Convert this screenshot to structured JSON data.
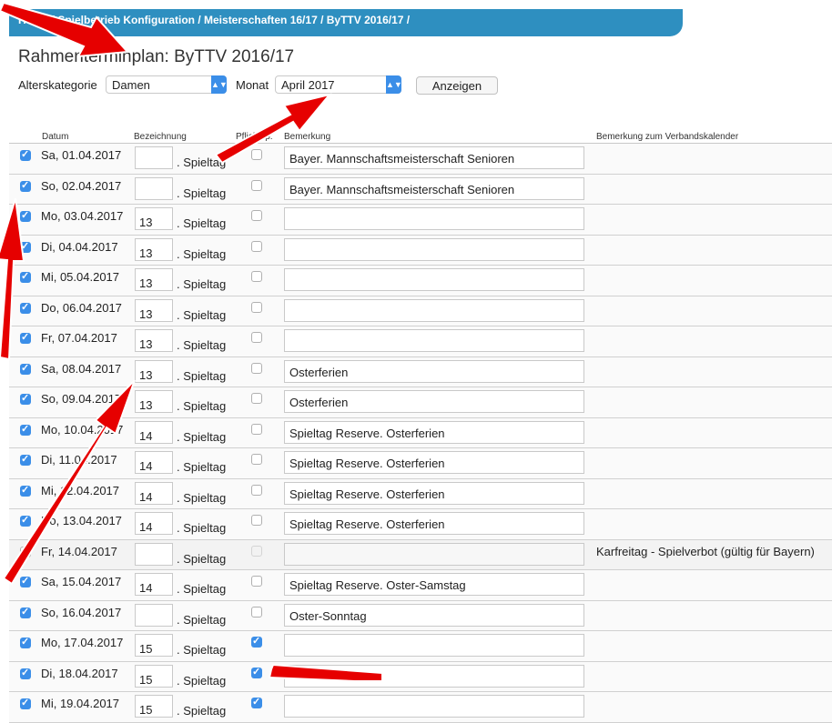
{
  "breadcrumb": "Home / Spielbetrieb Konfiguration / Meisterschaften 16/17 / ByTTV 2016/17 /",
  "page_title": "Rahmenterminplan: ByTTV 2016/17",
  "filters": {
    "alterskategorie_label": "Alterskategorie",
    "alterskategorie_value": "Damen",
    "monat_label": "Monat",
    "monat_value": "April 2017",
    "anzeigen_label": "Anzeigen"
  },
  "columns": {
    "datum": "Datum",
    "bezeichnung": "Bezeichnung",
    "pflicht": "Pflichtsp.",
    "bemerkung": "Bemerkung",
    "verband": "Bemerkung zum Verbandskalender"
  },
  "spieltag_suffix": ". Spieltag",
  "rows": [
    {
      "checked": true,
      "date": "Sa, 01.04.2017",
      "num": "",
      "pflicht": false,
      "pflicht_disabled": false,
      "bemerkung": "Bayer. Mannschaftsmeisterschaft Senioren",
      "verband": "",
      "holiday": false
    },
    {
      "checked": true,
      "date": "So, 02.04.2017",
      "num": "",
      "pflicht": false,
      "pflicht_disabled": false,
      "bemerkung": "Bayer. Mannschaftsmeisterschaft Senioren",
      "verband": "",
      "holiday": false
    },
    {
      "checked": true,
      "date": "Mo, 03.04.2017",
      "num": "13",
      "pflicht": false,
      "pflicht_disabled": false,
      "bemerkung": "",
      "verband": "",
      "holiday": false
    },
    {
      "checked": true,
      "date": "Di, 04.04.2017",
      "num": "13",
      "pflicht": false,
      "pflicht_disabled": false,
      "bemerkung": "",
      "verband": "",
      "holiday": false
    },
    {
      "checked": true,
      "date": "Mi, 05.04.2017",
      "num": "13",
      "pflicht": false,
      "pflicht_disabled": false,
      "bemerkung": "",
      "verband": "",
      "holiday": false
    },
    {
      "checked": true,
      "date": "Do, 06.04.2017",
      "num": "13",
      "pflicht": false,
      "pflicht_disabled": false,
      "bemerkung": "",
      "verband": "",
      "holiday": false
    },
    {
      "checked": true,
      "date": "Fr, 07.04.2017",
      "num": "13",
      "pflicht": false,
      "pflicht_disabled": false,
      "bemerkung": "",
      "verband": "",
      "holiday": false
    },
    {
      "checked": true,
      "date": "Sa, 08.04.2017",
      "num": "13",
      "pflicht": false,
      "pflicht_disabled": false,
      "bemerkung": "Osterferien",
      "verband": "",
      "holiday": false
    },
    {
      "checked": true,
      "date": "So, 09.04.2017",
      "num": "13",
      "pflicht": false,
      "pflicht_disabled": false,
      "bemerkung": "Osterferien",
      "verband": "",
      "holiday": false
    },
    {
      "checked": true,
      "date": "Mo, 10.04.2017",
      "num": "14",
      "pflicht": false,
      "pflicht_disabled": false,
      "bemerkung": "Spieltag Reserve. Osterferien",
      "verband": "",
      "holiday": false
    },
    {
      "checked": true,
      "date": "Di, 11.04.2017",
      "num": "14",
      "pflicht": false,
      "pflicht_disabled": false,
      "bemerkung": "Spieltag Reserve. Osterferien",
      "verband": "",
      "holiday": false
    },
    {
      "checked": true,
      "date": "Mi, 12.04.2017",
      "num": "14",
      "pflicht": false,
      "pflicht_disabled": false,
      "bemerkung": "Spieltag Reserve. Osterferien",
      "verband": "",
      "holiday": false
    },
    {
      "checked": true,
      "date": "Do, 13.04.2017",
      "num": "14",
      "pflicht": false,
      "pflicht_disabled": false,
      "bemerkung": "Spieltag Reserve. Osterferien",
      "verband": "",
      "holiday": false
    },
    {
      "checked": false,
      "date": "Fr, 14.04.2017",
      "num": "",
      "pflicht": false,
      "pflicht_disabled": true,
      "bemerkung": "",
      "verband": "Karfreitag - Spielverbot (gültig für Bayern)",
      "holiday": true
    },
    {
      "checked": true,
      "date": "Sa, 15.04.2017",
      "num": "14",
      "pflicht": false,
      "pflicht_disabled": false,
      "bemerkung": "Spieltag Reserve. Oster-Samstag",
      "verband": "",
      "holiday": false
    },
    {
      "checked": true,
      "date": "So, 16.04.2017",
      "num": "",
      "pflicht": false,
      "pflicht_disabled": false,
      "bemerkung": "Oster-Sonntag",
      "verband": "",
      "holiday": false
    },
    {
      "checked": true,
      "date": "Mo, 17.04.2017",
      "num": "15",
      "pflicht": true,
      "pflicht_disabled": false,
      "bemerkung": "",
      "verband": "",
      "holiday": false
    },
    {
      "checked": true,
      "date": "Di, 18.04.2017",
      "num": "15",
      "pflicht": true,
      "pflicht_disabled": false,
      "bemerkung": "",
      "verband": "",
      "holiday": false
    },
    {
      "checked": true,
      "date": "Mi, 19.04.2017",
      "num": "15",
      "pflicht": true,
      "pflicht_disabled": false,
      "bemerkung": "",
      "verband": "",
      "holiday": false
    }
  ],
  "colors": {
    "accent": "#2e8fc0",
    "checkbox": "#3b8ee8",
    "annotation_arrow": "#e60000"
  }
}
